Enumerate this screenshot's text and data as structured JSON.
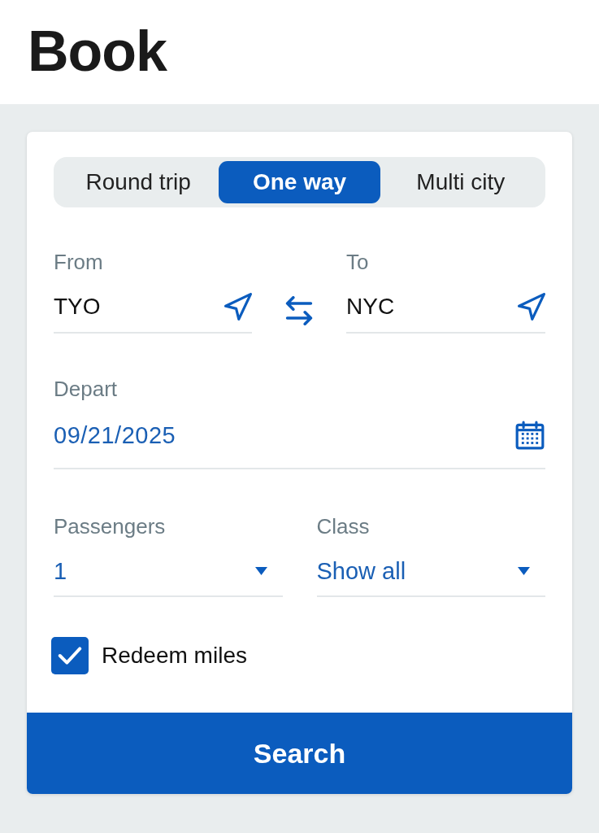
{
  "header": {
    "title": "Book"
  },
  "trip_type_tabs": [
    {
      "label": "Round trip",
      "selected": false
    },
    {
      "label": "One way",
      "selected": true
    },
    {
      "label": "Multi city",
      "selected": false
    }
  ],
  "route": {
    "from": {
      "label": "From",
      "value": "TYO"
    },
    "to": {
      "label": "To",
      "value": "NYC"
    }
  },
  "depart": {
    "label": "Depart",
    "value": "09/21/2025"
  },
  "passengers": {
    "label": "Passengers",
    "value": "1"
  },
  "travel_class": {
    "label": "Class",
    "value": "Show all"
  },
  "redeem_miles": {
    "label": "Redeem miles",
    "checked": true
  },
  "search_button": {
    "label": "Search"
  }
}
